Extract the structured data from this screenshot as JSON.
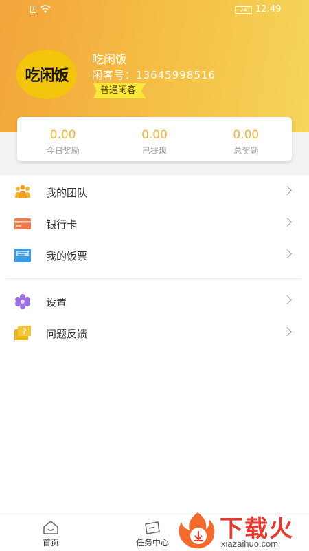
{
  "status_bar": {
    "time": "12:49",
    "battery": "74"
  },
  "profile": {
    "logo_text": "吃闲饭",
    "name": "吃闲饭",
    "member_label": "闲客号：",
    "member_id": "13645998516",
    "level": "普通闲客"
  },
  "stats": [
    {
      "value": "0.00",
      "label": "今日奖励"
    },
    {
      "value": "0.00",
      "label": "已提现"
    },
    {
      "value": "0.00",
      "label": "总奖励"
    }
  ],
  "menu_group1": [
    {
      "label": "我的团队",
      "icon": "team-icon"
    },
    {
      "label": "银行卡",
      "icon": "bank-card-icon"
    },
    {
      "label": "我的饭票",
      "icon": "meal-ticket-icon"
    }
  ],
  "menu_group2": [
    {
      "label": "设置",
      "icon": "settings-icon"
    },
    {
      "label": "问题反馈",
      "icon": "feedback-icon"
    }
  ],
  "tabbar": [
    {
      "label": "首页",
      "icon": "home-icon"
    },
    {
      "label": "任务中心",
      "icon": "task-icon"
    }
  ],
  "watermark": {
    "brand": "下载火",
    "url": "xiazaihuo.com"
  },
  "colors": {
    "accent": "#f3a43a",
    "stat_value": "#f0b637",
    "badge": "#f8e83a"
  }
}
